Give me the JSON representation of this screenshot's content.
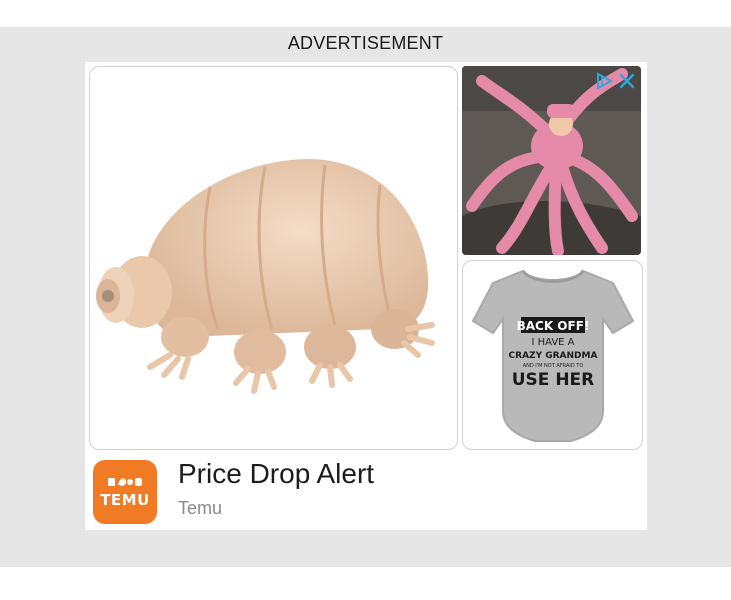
{
  "ad": {
    "label": "ADVERTISEMENT",
    "headline": "Price Drop Alert",
    "advertiser": "Temu",
    "logo_text": "TEMU",
    "brand_color": "#f17a24",
    "accent_color": "#2aa8e0",
    "onesie_text": {
      "line1": "BACK OFF!",
      "line2": "I HAVE A",
      "line3": "CRAZY GRANDMA",
      "line4": "AND I'M NOT AFRAID TO",
      "line5": "USE HER"
    },
    "icons": {
      "adchoices": "adchoices-icon",
      "close": "close-icon"
    }
  }
}
